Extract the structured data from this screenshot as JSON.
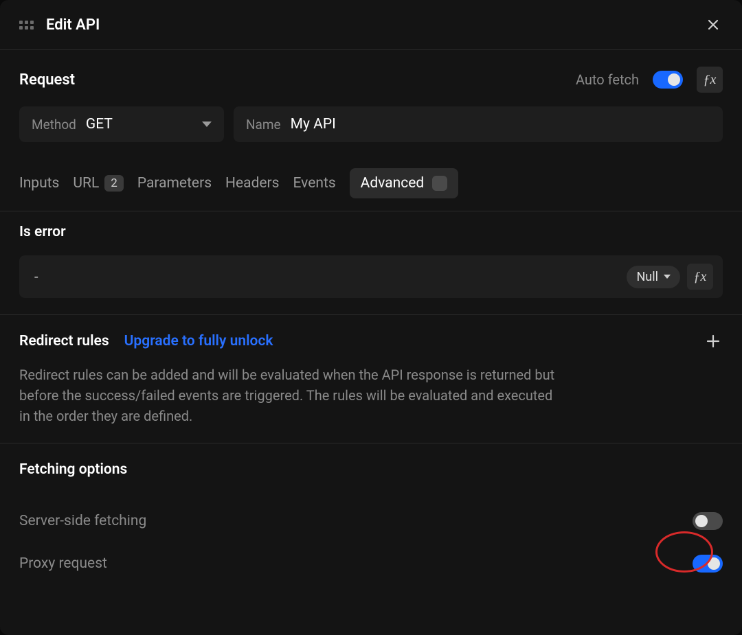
{
  "header": {
    "title": "Edit API"
  },
  "request": {
    "section_title": "Request",
    "auto_fetch_label": "Auto fetch",
    "method_label": "Method",
    "method_value": "GET",
    "name_label": "Name",
    "name_value": "My API"
  },
  "tabs": {
    "inputs": "Inputs",
    "url": "URL",
    "url_badge": "2",
    "parameters": "Parameters",
    "headers": "Headers",
    "events": "Events",
    "advanced": "Advanced"
  },
  "is_error": {
    "label": "Is error",
    "value": "-",
    "type_label": "Null"
  },
  "redirect": {
    "title": "Redirect rules",
    "upgrade_text": "Upgrade to fully unlock",
    "description": "Redirect rules can be added and will be evaluated when the API response is returned but before the success/failed events are triggered. The rules will be evaluated and executed in the order they are defined."
  },
  "fetching": {
    "title": "Fetching options",
    "server_side_label": "Server-side fetching",
    "proxy_label": "Proxy request"
  }
}
